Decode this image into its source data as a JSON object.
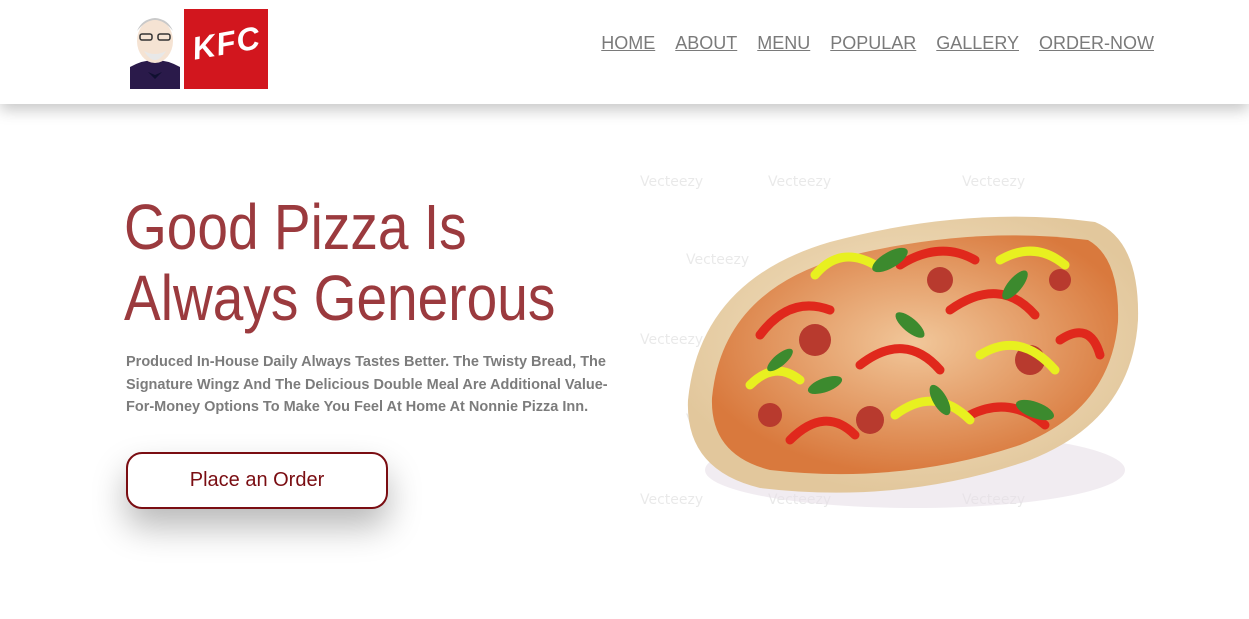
{
  "brand": {
    "logo_text": "KFC",
    "colors": {
      "brand_red": "#d2161e",
      "title": "#9b3a3e",
      "button": "#7a0d12"
    }
  },
  "nav": {
    "items": [
      "HOME",
      "ABOUT",
      "MENU",
      "POPULAR",
      "GALLERY",
      "ORDER-NOW"
    ]
  },
  "hero": {
    "title": "Good Pizza Is Always Generous",
    "subtitle": "Produced In-House Daily Always Tastes Better. The Twisty Bread, The Signature Wingz And The Delicious Double Meal Are Additional Value-For-Money Options To Make You Feel At Home At Nonnie Pizza Inn.",
    "cta": "Place an Order"
  },
  "image": {
    "watermark": "Vecteezy"
  }
}
